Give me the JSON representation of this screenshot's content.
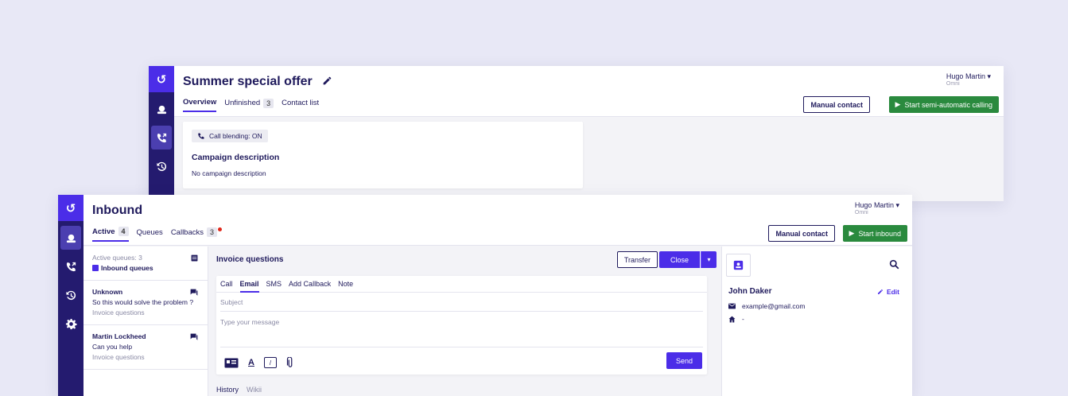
{
  "back": {
    "title": "Summer special offer",
    "tabs": [
      {
        "label": "Overview"
      },
      {
        "label": "Unfinished",
        "count": "3"
      },
      {
        "label": "Contact list"
      }
    ],
    "user": {
      "name": "Hugo Martin",
      "role": "Omni"
    },
    "manual_contact": "Manual contact",
    "start_button": "Start semi-automatic calling",
    "blending": "Call blending: ON",
    "desc_title": "Campaign description",
    "desc_text": "No campaign description"
  },
  "front": {
    "title": "Inbound",
    "tabs": [
      {
        "label": "Active",
        "count": "4"
      },
      {
        "label": "Queues"
      },
      {
        "label": "Callbacks",
        "count": "3"
      }
    ],
    "user": {
      "name": "Hugo Martin",
      "role": "Omni"
    },
    "manual_contact": "Manual contact",
    "start_button": "Start inbound",
    "queues": {
      "active_label": "Active queues: 3",
      "link": "Inbound queues"
    },
    "conversations": [
      {
        "name": "Unknown",
        "message": "So this would solve the problem ?",
        "queue": "Invoice questions"
      },
      {
        "name": "Martin Lockheed",
        "message": "Can you help",
        "queue": "Invoice questions"
      }
    ],
    "center": {
      "title": "Invoice questions",
      "transfer": "Transfer",
      "close": "Close",
      "channel_tabs": [
        "Call",
        "Email",
        "SMS",
        "Add Callback",
        "Note"
      ],
      "subject_placeholder": "Subject",
      "message_placeholder": "Type your message",
      "send": "Send",
      "bottom_tabs": [
        "History",
        "Wikii"
      ]
    },
    "contact": {
      "name": "John Daker",
      "edit": "Edit",
      "email": "example@gmail.com",
      "address": "-"
    }
  },
  "colors": {
    "rail": "#241b6f",
    "brand": "#4b2de8",
    "green": "#2a8a3e",
    "background": "#e8e8f6"
  }
}
